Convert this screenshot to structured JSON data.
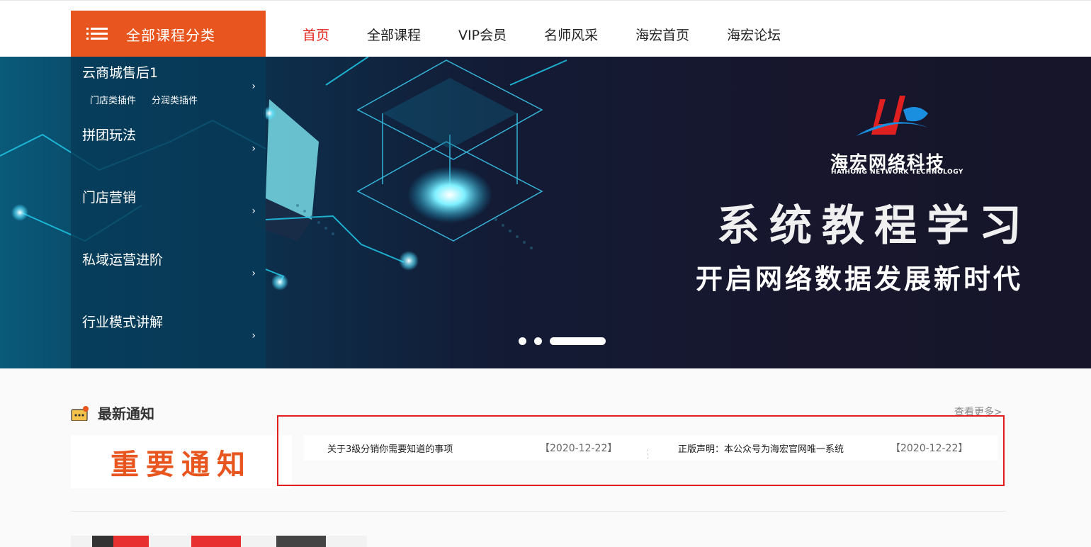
{
  "header": {
    "category_button": "全部课程分类",
    "nav": [
      {
        "label": "首页",
        "active": true
      },
      {
        "label": "全部课程",
        "active": false
      },
      {
        "label": "VIP会员",
        "active": false
      },
      {
        "label": "名师风采",
        "active": false
      },
      {
        "label": "海宏首页",
        "active": false
      },
      {
        "label": "海宏论坛",
        "active": false
      }
    ]
  },
  "sidebar": {
    "items": [
      {
        "label": "云商城售后1",
        "subs": [
          "门店类插件",
          "分润类插件"
        ]
      },
      {
        "label": "拼团玩法"
      },
      {
        "label": "门店营销"
      },
      {
        "label": "私域运营进阶"
      },
      {
        "label": "行业模式讲解"
      }
    ],
    "chevron": "›"
  },
  "banner": {
    "brand_cn": "海宏网络科技",
    "brand_en": "HAIHONG NETWORK TECHNOLOGY",
    "title": "系统教程学习",
    "subtitle": "开启网络数据发展新时代",
    "slides": 3,
    "active_slide": 3
  },
  "notice": {
    "title": "最新通知",
    "more": "查看更多>",
    "image_text": "重要通知",
    "items": [
      {
        "text": "关于3级分销你需要知道的事项",
        "date": "【2020-12-22】"
      },
      {
        "text": "正版声明：本公众号为海宏官网唯一系统",
        "date": "【2020-12-22】"
      }
    ]
  },
  "colors": {
    "accent": "#e8551e",
    "nav_active": "#e2231a",
    "highlight_border": "#e02020"
  }
}
